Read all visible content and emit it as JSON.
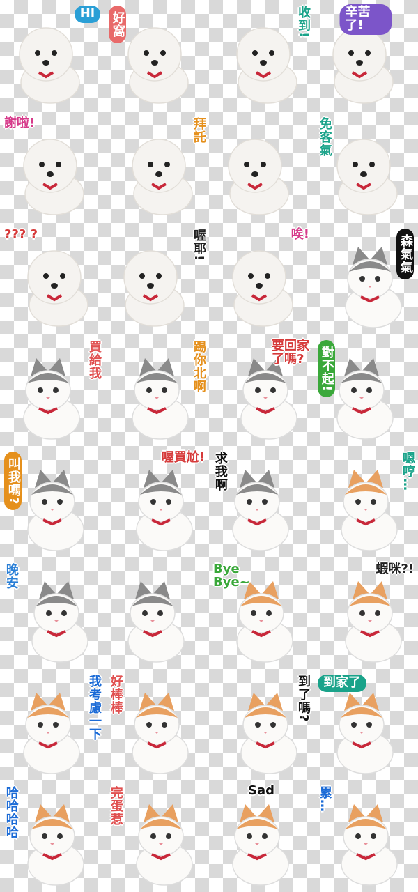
{
  "colors": {
    "dog_body": "#f5f3f0",
    "cat_grey": "#8a8a8a",
    "cat_orange": "#e8a060",
    "collar_red": "#c8283a",
    "checker_grey": "#d9d9d9"
  },
  "stickers": [
    {
      "animal": "dog",
      "caption": "Hi",
      "color": "#2a9fd6",
      "bubble": true,
      "vertical": false,
      "pos": "tr"
    },
    {
      "animal": "dog",
      "caption": "好窩",
      "color": "#e86a6a",
      "bubble": true,
      "vertical": true,
      "pos": "tl"
    },
    {
      "animal": "dog",
      "caption": "收到!",
      "color": "#1aa38a",
      "bubble": false,
      "vertical": true,
      "pos": "tr"
    },
    {
      "animal": "dog",
      "caption": "辛苦了!",
      "color": "#7c55c9",
      "bubble": true,
      "vertical": false,
      "pos": "tc"
    },
    {
      "animal": "dog",
      "caption": "謝啦!",
      "color": "#d63a8a",
      "bubble": false,
      "vertical": false,
      "pos": "tl"
    },
    {
      "animal": "dog",
      "caption": "拜託",
      "color": "#e5901c",
      "bubble": false,
      "vertical": true,
      "pos": "tr"
    },
    {
      "animal": "dog",
      "caption": "",
      "color": "#e8607a",
      "bubble": false,
      "vertical": false,
      "pos": "tr"
    },
    {
      "animal": "dog",
      "caption": "免客氣",
      "color": "#1aa38a",
      "bubble": false,
      "vertical": true,
      "pos": "tl"
    },
    {
      "animal": "dog",
      "caption": "??? ?",
      "color": "#d63a3a",
      "bubble": false,
      "vertical": false,
      "pos": "tl"
    },
    {
      "animal": "dog",
      "caption": "喔耶!",
      "color": "#222222",
      "bubble": false,
      "vertical": true,
      "pos": "tr"
    },
    {
      "animal": "dog",
      "caption": "唉!",
      "color": "#d63a8a",
      "bubble": false,
      "vertical": false,
      "pos": "tr"
    },
    {
      "animal": "cat-grey",
      "caption": "森氣氣",
      "color": "#111111",
      "bubble": true,
      "vertical": true,
      "pos": "tr"
    },
    {
      "animal": "cat-grey",
      "caption": "買給我",
      "color": "#e05050",
      "bubble": false,
      "vertical": true,
      "pos": "tr"
    },
    {
      "animal": "cat-grey",
      "caption": "踢你北啊",
      "color": "#e5901c",
      "bubble": false,
      "vertical": true,
      "pos": "tr"
    },
    {
      "animal": "cat-grey",
      "caption": "要回家\n了嗎?",
      "color": "#d63a3a",
      "bubble": false,
      "vertical": false,
      "pos": "tr"
    },
    {
      "animal": "cat-grey",
      "caption": "對不起!",
      "color": "#3aa83a",
      "bubble": true,
      "vertical": true,
      "pos": "tl"
    },
    {
      "animal": "cat-grey",
      "caption": "叫我嗎?",
      "color": "#e5901c",
      "bubble": true,
      "vertical": true,
      "pos": "tl"
    },
    {
      "animal": "cat-grey",
      "caption": "喔買尬!",
      "color": "#d63a3a",
      "bubble": false,
      "vertical": false,
      "pos": "tr"
    },
    {
      "animal": "cat-grey",
      "caption": "求我啊",
      "color": "#111111",
      "bubble": false,
      "vertical": true,
      "pos": "tl"
    },
    {
      "animal": "cat-orange",
      "caption": "嗯哼…",
      "color": "#1aa38a",
      "bubble": false,
      "vertical": true,
      "pos": "tr"
    },
    {
      "animal": "cat-grey",
      "caption": "晚安",
      "color": "#2a7fd6",
      "bubble": false,
      "vertical": true,
      "pos": "tl"
    },
    {
      "animal": "cat-grey",
      "caption": "",
      "color": "#e8607a",
      "bubble": false,
      "vertical": false,
      "pos": "tl"
    },
    {
      "animal": "cat-orange",
      "caption": "Bye\nBye~",
      "color": "#3aa83a",
      "bubble": false,
      "vertical": false,
      "pos": "tl"
    },
    {
      "animal": "cat-orange",
      "caption": "蝦咪?!",
      "color": "#222222",
      "bubble": false,
      "vertical": false,
      "pos": "tr"
    },
    {
      "animal": "cat-orange",
      "caption": "我考慮一下",
      "color": "#1a6ad6",
      "bubble": false,
      "vertical": true,
      "pos": "tr"
    },
    {
      "animal": "cat-orange",
      "caption": "好棒棒",
      "color": "#e05050",
      "bubble": false,
      "vertical": true,
      "pos": "tl"
    },
    {
      "animal": "cat-orange",
      "caption": "到了嗎?",
      "color": "#111111",
      "bubble": false,
      "vertical": true,
      "pos": "tr"
    },
    {
      "animal": "cat-orange",
      "caption": "到家了",
      "color": "#1aa38a",
      "bubble": true,
      "vertical": false,
      "pos": "tl"
    },
    {
      "animal": "cat-orange",
      "caption": "哈哈哈哈",
      "color": "#1a6ad6",
      "bubble": false,
      "vertical": true,
      "pos": "tl"
    },
    {
      "animal": "cat-orange",
      "caption": "完蛋惹",
      "color": "#e05050",
      "bubble": false,
      "vertical": true,
      "pos": "tl"
    },
    {
      "animal": "cat-orange",
      "caption": "Sad",
      "color": "#111111",
      "bubble": false,
      "vertical": false,
      "pos": "tc"
    },
    {
      "animal": "cat-orange",
      "caption": "累…",
      "color": "#1a6ad6",
      "bubble": false,
      "vertical": true,
      "pos": "tl"
    }
  ]
}
